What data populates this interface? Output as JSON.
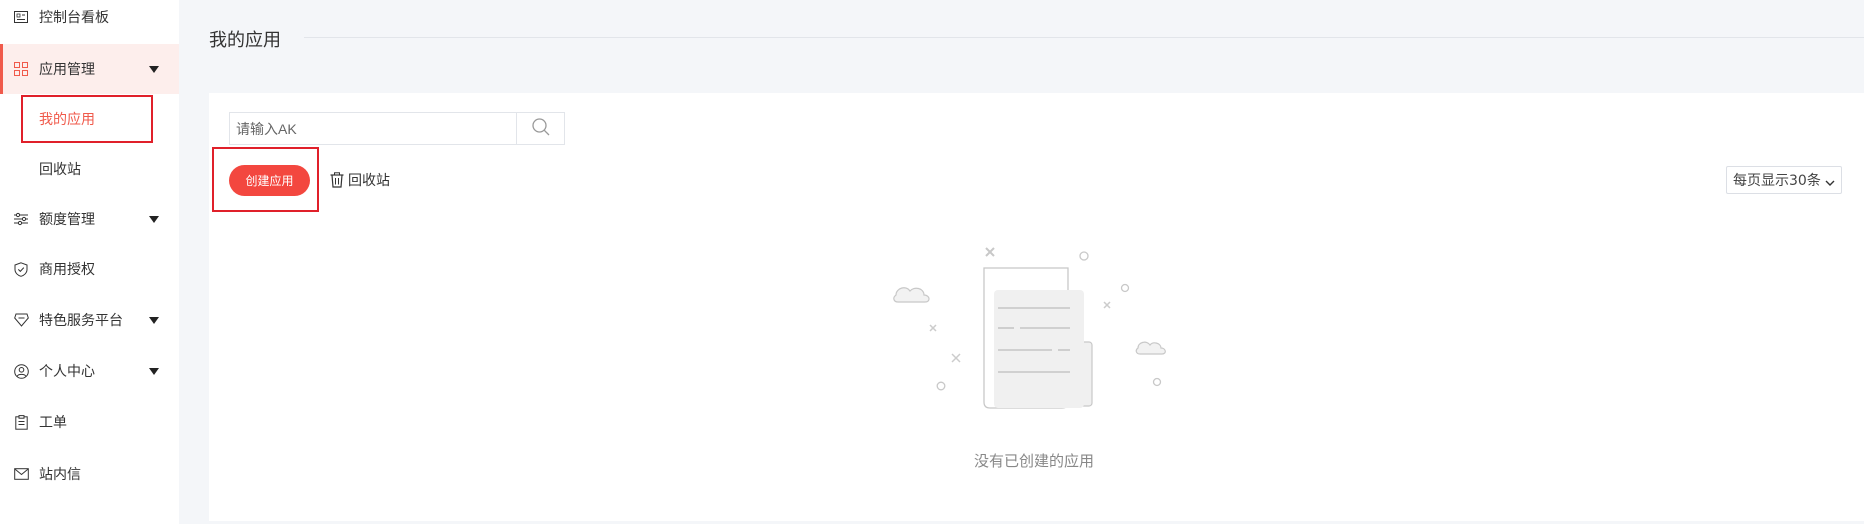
{
  "sidebar": {
    "items": [
      {
        "label": "控制台看板",
        "icon": "dashboard-icon"
      },
      {
        "label": "应用管理",
        "icon": "grid-icon",
        "expanded": true
      },
      {
        "label": "我的应用",
        "sub": true,
        "selected": true
      },
      {
        "label": "回收站",
        "sub": true
      },
      {
        "label": "额度管理",
        "icon": "sliders-icon",
        "expandable": true
      },
      {
        "label": "商用授权",
        "icon": "shield-icon"
      },
      {
        "label": "特色服务平台",
        "icon": "diamond-icon",
        "expandable": true
      },
      {
        "label": "个人中心",
        "icon": "user-circle-icon",
        "expandable": true
      },
      {
        "label": "工单",
        "icon": "clipboard-icon"
      },
      {
        "label": "站内信",
        "icon": "mail-icon"
      }
    ]
  },
  "main": {
    "title": "我的应用",
    "search": {
      "placeholder": "请输入AK"
    },
    "create_button": "创建应用",
    "recycle_link": "回收站",
    "page_size": "每页显示30条",
    "empty_text": "没有已创建的应用"
  },
  "colors": {
    "accent": "#f3473f",
    "highlight_border": "#e0202a",
    "active_bg": "#fdeeec"
  }
}
